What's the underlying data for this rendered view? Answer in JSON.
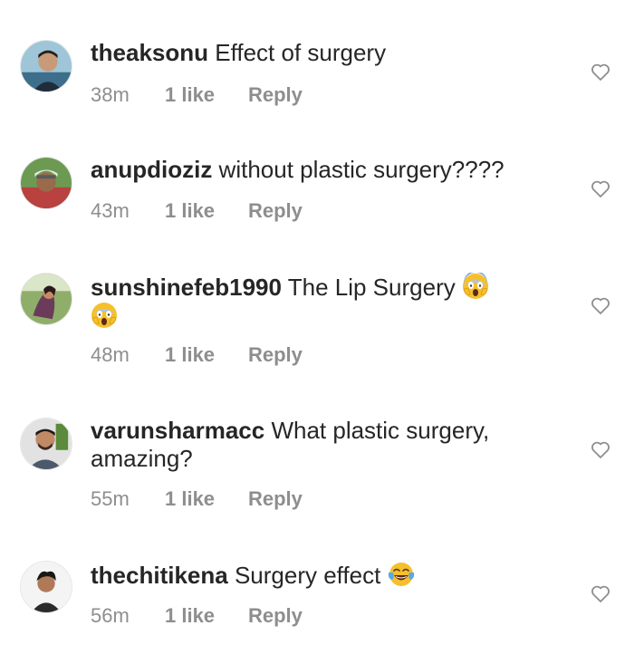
{
  "comments": [
    {
      "username": "theaksonu",
      "text": " Effect of surgery",
      "time": "38m",
      "likes": "1 like",
      "reply": "Reply"
    },
    {
      "username": "anupdioziz",
      "text": " without plastic surgery????",
      "time": "43m",
      "likes": "1 like",
      "reply": "Reply"
    },
    {
      "username": "sunshinefeb1990",
      "text": " The Lip Surgery",
      "time": "48m",
      "likes": "1 like",
      "reply": "Reply",
      "emojis": [
        "face-screaming-in-fear",
        "face-screaming-in-fear"
      ]
    },
    {
      "username": "varunsharmacc",
      "text": " What plastic surgery, amazing?",
      "time": "55m",
      "likes": "1 like",
      "reply": "Reply"
    },
    {
      "username": "thechitikena",
      "text": " Surgery effect",
      "time": "56m",
      "likes": "1 like",
      "reply": "Reply",
      "emojis": [
        "face-with-tears-of-joy"
      ]
    }
  ],
  "colors": {
    "text": "#262626",
    "meta": "#8e8e8e",
    "heart": "#8e8e8e",
    "emoji_face": "#f6c02c"
  }
}
